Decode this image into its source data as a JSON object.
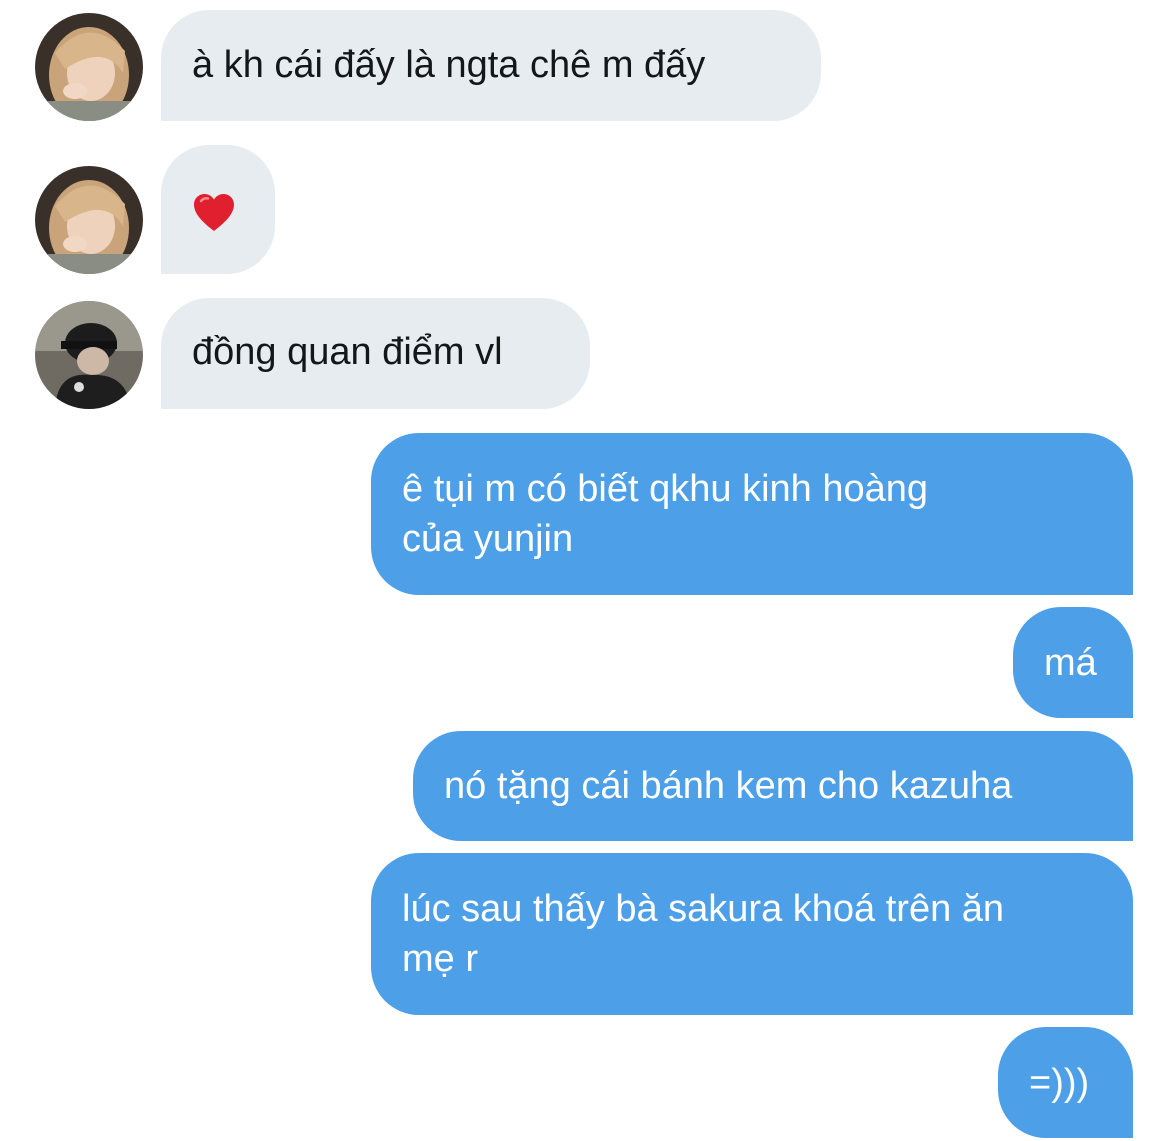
{
  "messages": [
    {
      "id": "m1",
      "side": "incoming",
      "sender_avatar": "avatar-girl-blonde",
      "lines": [
        "à kh cái đấy là ngta chê m đấy"
      ]
    },
    {
      "id": "m2",
      "side": "incoming",
      "sender_avatar": "avatar-girl-blonde",
      "emoji": "heart-emoji"
    },
    {
      "id": "m3",
      "side": "incoming",
      "sender_avatar": "avatar-girl-cap",
      "lines": [
        "đồng quan điểm vl"
      ]
    },
    {
      "id": "m4",
      "side": "outgoing",
      "lines": [
        "ê tụi m có biết qkhu kinh hoàng",
        "của yunjin"
      ]
    },
    {
      "id": "m5",
      "side": "outgoing",
      "lines": [
        "má"
      ]
    },
    {
      "id": "m6",
      "side": "outgoing",
      "lines": [
        "nó tặng cái bánh kem cho kazuha"
      ]
    },
    {
      "id": "m7",
      "side": "outgoing",
      "lines": [
        "lúc sau thấy bà sakura khoá trên ăn",
        "mẹ r"
      ]
    },
    {
      "id": "m8",
      "side": "outgoing",
      "lines": [
        "=)))"
      ]
    }
  ],
  "colors": {
    "incoming_bubble": "#e6ecf0",
    "incoming_text": "#14171a",
    "outgoing_bubble": "#4d9fe8",
    "outgoing_text": "#ffffff",
    "heart": "#e0202e"
  }
}
